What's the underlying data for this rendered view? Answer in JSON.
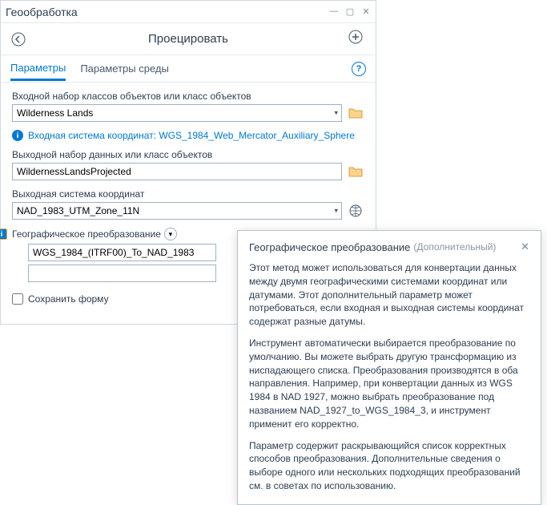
{
  "panel": {
    "title": "Геообработка",
    "tool_title": "Проецировать"
  },
  "tabs": {
    "parameters": "Параметры",
    "environment": "Параметры среды"
  },
  "fields": {
    "input_fc_label": "Входной набор классов объектов или класс объектов",
    "input_fc_value": "Wilderness Lands",
    "input_cs_info": "Входная система координат: WGS_1984_Web_Mercator_Auxiliary_Sphere",
    "output_fc_label": "Выходной набор данных или класс объектов",
    "output_fc_value": "WildernessLandsProjected",
    "output_cs_label": "Выходная система координат",
    "output_cs_value": "NAD_1983_UTM_Zone_11N",
    "geotrans_label": "Географическое преобразование",
    "geotrans_value": "WGS_1984_(ITRF00)_To_NAD_1983",
    "preserve_shape": "Сохранить форму"
  },
  "tooltip": {
    "title": "Географическое преобразование",
    "subtitle": "(Дополнительный)",
    "para1": "Этот метод может использоваться для конвертации данных между двумя географическими системами координат или датумами. Этот дополнительный параметр может потребоваться, если входная и выходная системы координат содержат разные датумы.",
    "para2": "Инструмент автоматически выбирается преобразование по умолчанию. Вы можете выбрать другую трансформацию из ниспадающего списка. Преобразования производятся в оба направления. Например, при конвертации данных из WGS 1984 в NAD 1927, можно выбрать преобразование под названием NAD_1927_to_WGS_1984_3, и инструмент применит его корректно.",
    "para3": "Параметр содержит раскрывающийся список корректных способов преобразования. Дополнительные сведения о выборе одного или нескольких подходящих преобразований см. в советах по использованию."
  }
}
